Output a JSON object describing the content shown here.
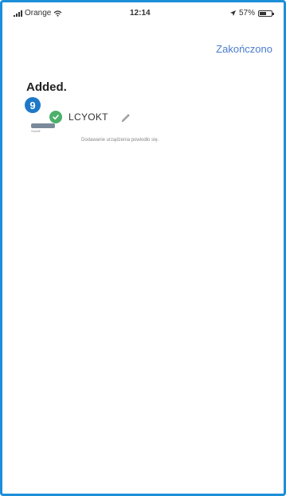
{
  "status_bar": {
    "carrier": "Orange",
    "time": "12:14",
    "battery_percent": "57%",
    "battery_level": 0.57
  },
  "header": {
    "done_label": "Zakończono"
  },
  "section": {
    "title": "Added."
  },
  "step_badge": "9",
  "device": {
    "name": "LCYOKT",
    "image_label": "Sonoff",
    "status_text": "Dodawanie urządzenia powiodło się."
  },
  "colors": {
    "accent": "#4a7bd0",
    "badge": "#1e78c8",
    "success": "#4caf6a",
    "frame_border": "#1d8ed8"
  }
}
